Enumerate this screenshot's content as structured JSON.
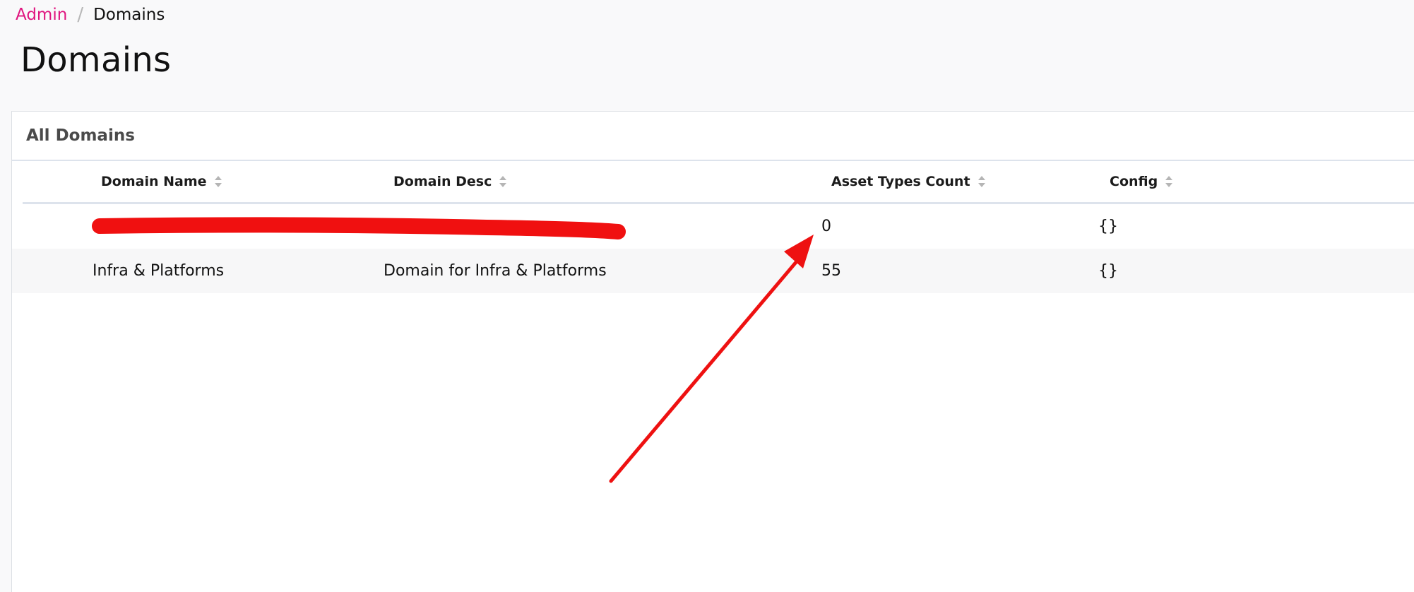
{
  "breadcrumb": {
    "parent": "Admin",
    "separator": "/",
    "current": "Domains"
  },
  "page": {
    "title": "Domains"
  },
  "card": {
    "title": "All Domains"
  },
  "table": {
    "columns": [
      {
        "label": "Domain Name",
        "icon": "sort-icon"
      },
      {
        "label": "Domain Desc",
        "icon": "sort-icon"
      },
      {
        "label": "Asset Types Count",
        "icon": "sort-icon"
      },
      {
        "label": "Config",
        "icon": "sort-icon"
      }
    ],
    "rows": [
      {
        "name": "",
        "desc": "",
        "count": "0",
        "config": "{}",
        "redacted": true
      },
      {
        "name": "Infra & Platforms",
        "desc": "Domain for Infra & Platforms",
        "count": "55",
        "config": "{}",
        "redacted": false
      }
    ]
  },
  "colors": {
    "accent_link": "#e0157f",
    "annotation": "#ee1111"
  }
}
